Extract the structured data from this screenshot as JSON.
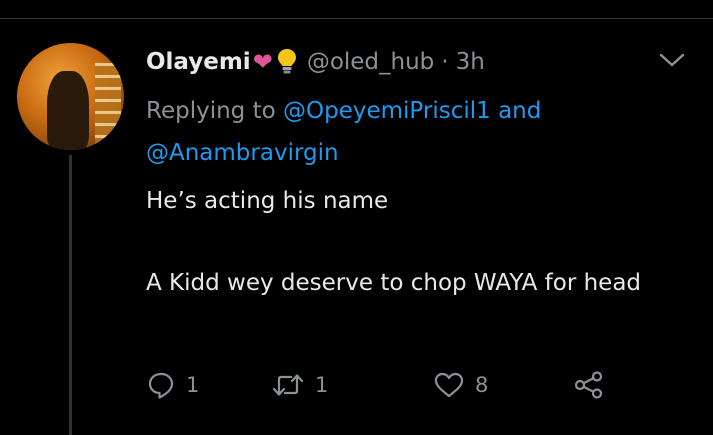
{
  "tweet": {
    "author": {
      "display_name": "Olayemi",
      "emojis": [
        "pink-heart",
        "light-bulb"
      ],
      "handle": "@oled_hub",
      "separator": "·",
      "time": "3h"
    },
    "replying_to": {
      "prefix": "Replying to",
      "mention_1": "@OpeyemiPriscil1",
      "conjunction": "and",
      "mention_2": "@Anambravirgin"
    },
    "text": {
      "line_1": "He’s acting his name",
      "line_2": "A Kidd wey deserve to chop WAYA for head"
    },
    "actions": {
      "reply_icon": "reply-icon",
      "reply_count": "1",
      "retweet_icon": "retweet-icon",
      "retweet_count": "1",
      "like_icon": "heart-icon",
      "like_count": "8",
      "share_icon": "share-icon"
    }
  },
  "colors": {
    "background": "#000000",
    "text": "#e7e9ea",
    "secondary": "#8b9297",
    "link": "#1d9bf0",
    "heart_emoji": "#e0569a",
    "bulb_emoji": "#f5c518"
  }
}
